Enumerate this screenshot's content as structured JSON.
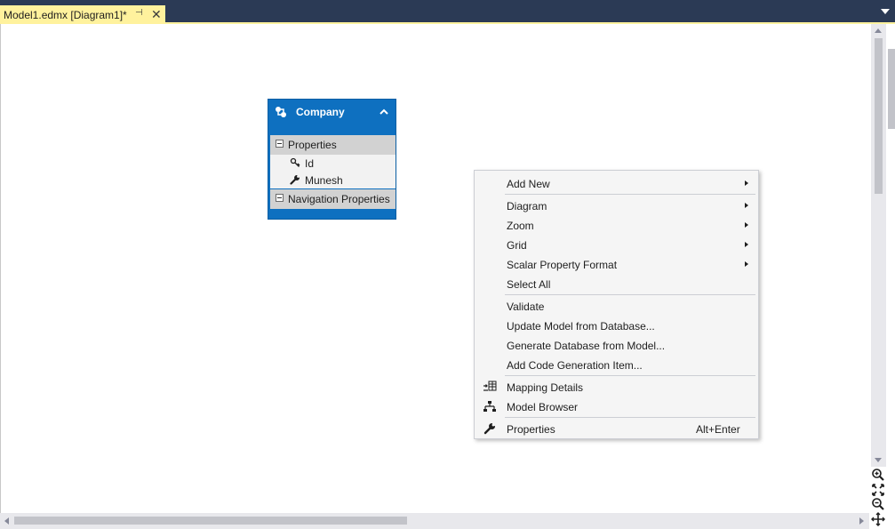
{
  "tab": {
    "title": "Model1.edmx [Diagram1]*",
    "pin_glyph": "⊣",
    "close_glyph": "✕"
  },
  "entity": {
    "title": "Company",
    "sections": {
      "properties": "Properties",
      "navigation": "Navigation Properties"
    },
    "properties": [
      {
        "name": "Id",
        "icon": "key-icon"
      },
      {
        "name": "Munesh",
        "icon": "wrench-icon"
      }
    ]
  },
  "context_menu": {
    "items": {
      "add_new": "Add New",
      "diagram": "Diagram",
      "zoom": "Zoom",
      "grid": "Grid",
      "scalar_property_format": "Scalar Property Format",
      "select_all": "Select All",
      "validate": "Validate",
      "update_model": "Update Model from Database...",
      "generate_database": "Generate Database from Model...",
      "add_code_generation": "Add Code Generation Item...",
      "mapping_details": "Mapping Details",
      "model_browser": "Model Browser",
      "properties": "Properties"
    },
    "shortcuts": {
      "properties": "Alt+Enter"
    }
  },
  "colors": {
    "tab_active": "#fff29d",
    "tab_strip": "#2b3a55",
    "entity_header": "#0e70c0",
    "menu_background": "#f5f5f5"
  }
}
